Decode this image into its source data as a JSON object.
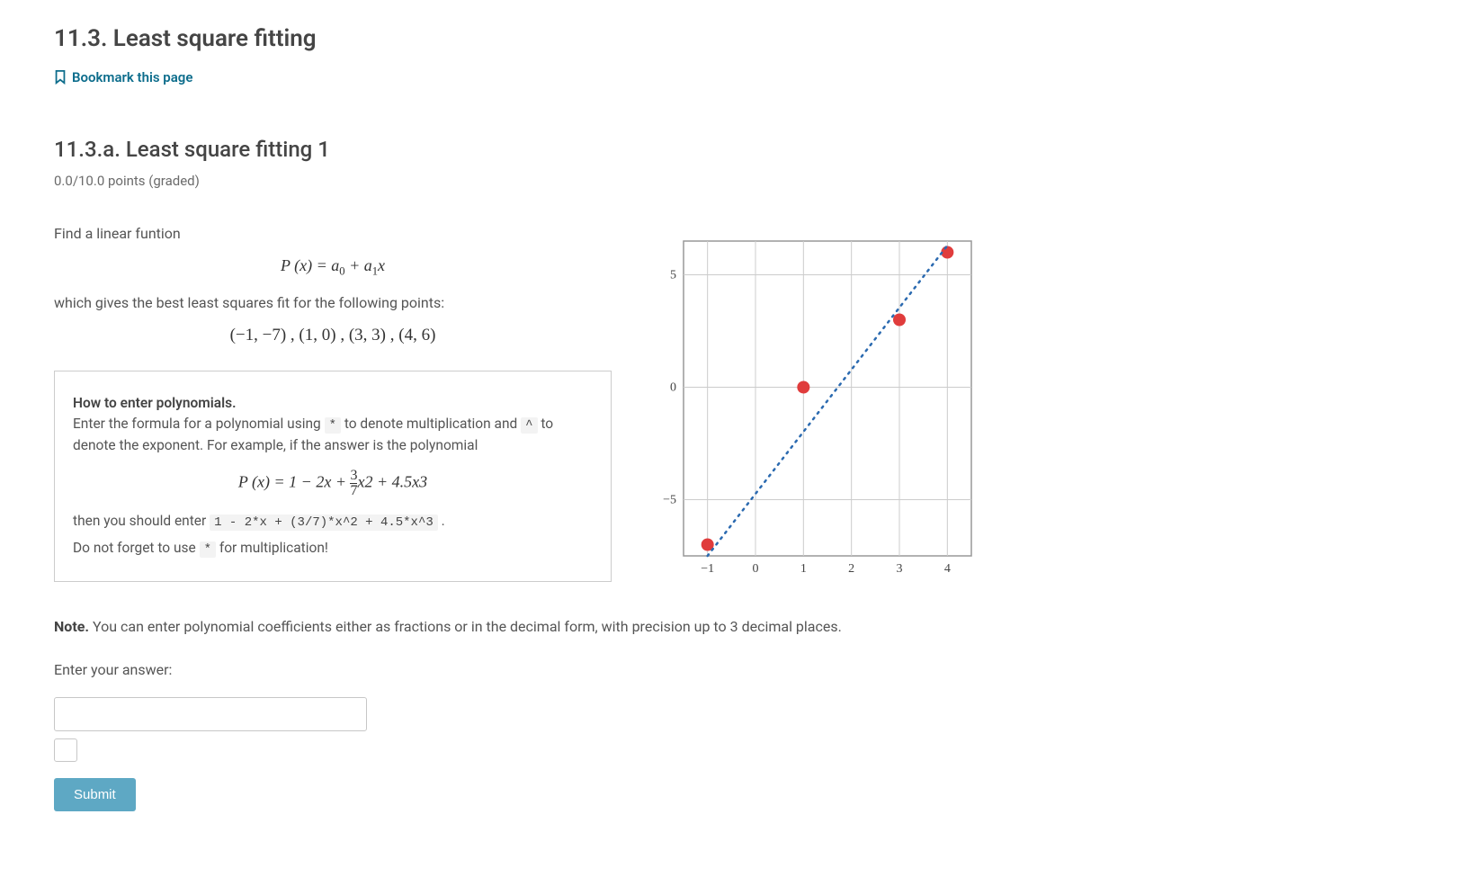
{
  "header": {
    "title": "11.3. Least square fitting",
    "bookmark_label": "Bookmark this page"
  },
  "problem": {
    "subtitle": "11.3.a. Least square fitting 1",
    "points": "0.0/10.0 points (graded)",
    "prompt_intro": "Find a linear funtion",
    "formula_main": "P (x) = a₀ + a₁x",
    "prompt_mid": "which gives the best least squares fit for the following points:",
    "points_list": "(−1, −7) ,   (1, 0) ,   (3, 3) ,   (4, 6)"
  },
  "hint": {
    "title": "How to enter polynomials.",
    "line1_pre": "Enter the formula for a polynomial using ",
    "code_star": "*",
    "line1_mid": " to denote multiplication and ",
    "code_caret": "^",
    "line1_post": " to denote the exponent. For example, if the answer is the polynomial",
    "formula_example": "P (x) = 1 − 2x + (3/7)x² + 4.5x³",
    "line2_pre": "then you should enter ",
    "code_example": "1 - 2*x + (3/7)*x^2 + 4.5*x^3",
    "line2_post": " .",
    "line3_pre": "Do not forget to use ",
    "code_star2": "*",
    "line3_post": " for multiplication!"
  },
  "note": {
    "label": "Note.",
    "text": " You can enter polynomial coefficients either as fractions or in the decimal form, with precision up to 3 decimal places."
  },
  "answer": {
    "label": "Enter your answer:",
    "value": ""
  },
  "submit_label": "Submit",
  "chart_data": {
    "type": "scatter",
    "title": "",
    "xlabel": "",
    "ylabel": "",
    "xlim": [
      -1.5,
      4.5
    ],
    "ylim": [
      -7.5,
      6.5
    ],
    "x_ticks": [
      -1,
      0,
      1,
      2,
      3,
      4
    ],
    "y_ticks": [
      -5,
      0,
      5
    ],
    "series": [
      {
        "name": "data-points",
        "type": "scatter",
        "x": [
          -1,
          1,
          3,
          4
        ],
        "y": [
          -7,
          0,
          3,
          6
        ]
      },
      {
        "name": "fit-line",
        "type": "line",
        "style": "dashed",
        "x": [
          -1,
          4
        ],
        "y": [
          -7.5,
          6.3
        ]
      }
    ]
  }
}
